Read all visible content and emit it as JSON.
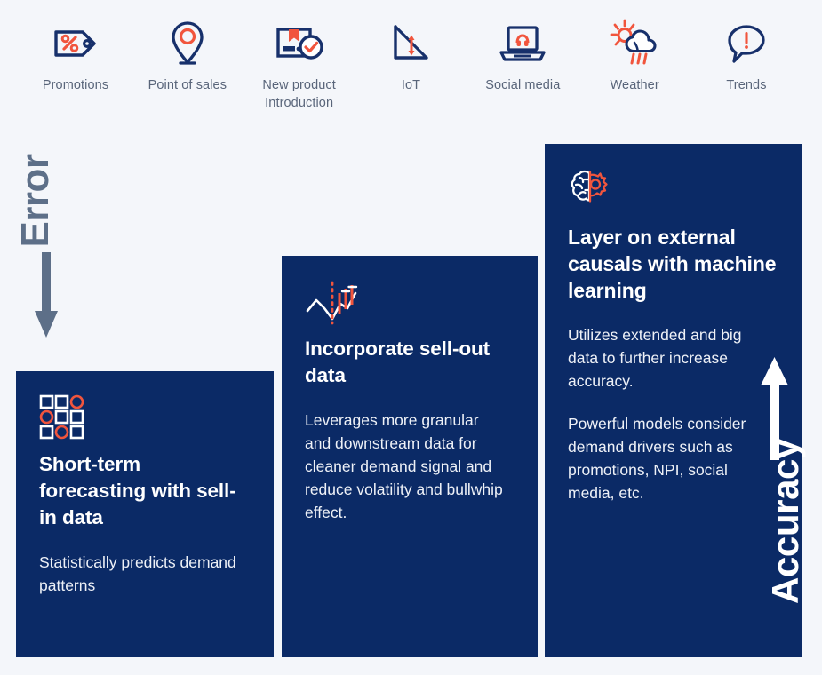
{
  "drivers": [
    {
      "id": "promotions",
      "icon": "price-tag-percent-icon",
      "label": "Promotions"
    },
    {
      "id": "point-of-sales",
      "icon": "map-pin-icon",
      "label": "Point of sales"
    },
    {
      "id": "npi",
      "icon": "package-check-icon",
      "label": "New product\nIntroduction"
    },
    {
      "id": "iot",
      "icon": "declining-chart-icon",
      "label": "IoT"
    },
    {
      "id": "social-media",
      "icon": "laptop-headset-icon",
      "label": "Social media"
    },
    {
      "id": "weather",
      "icon": "sun-cloud-rain-icon",
      "label": "Weather"
    },
    {
      "id": "trends",
      "icon": "speech-bubble-alert-icon",
      "label": "Trends"
    }
  ],
  "axes": {
    "error_label": "Error",
    "error_direction": "down",
    "accuracy_label": "Accuracy",
    "accuracy_direction": "up"
  },
  "panels": [
    {
      "id": "short-term",
      "icon": "grid-squares-circles-icon",
      "title": "Short-term forecasting with sell-in  data",
      "body": [
        "Statistically predicts demand patterns"
      ]
    },
    {
      "id": "sell-out",
      "icon": "line-candlestick-chart-icon",
      "title": "Incorporate sell-out data",
      "body": [
        "Leverages more granular and downstream data for cleaner demand signal and reduce volatility and bullwhip effect."
      ]
    },
    {
      "id": "machine-learning",
      "icon": "brain-gear-icon",
      "title": "Layer on external causals with machine learning",
      "body": [
        "Utilizes extended and big data to further increase accuracy.",
        "Powerful models consider demand drivers such as promotions, NPI, social media, etc."
      ]
    }
  ],
  "colors": {
    "background": "#f4f6fa",
    "panel_navy": "#0b2a66",
    "icon_navy": "#17306b",
    "accent_red": "#f1553d",
    "axis_gray": "#5d6f88",
    "label_gray": "#59657a",
    "white": "#ffffff"
  }
}
